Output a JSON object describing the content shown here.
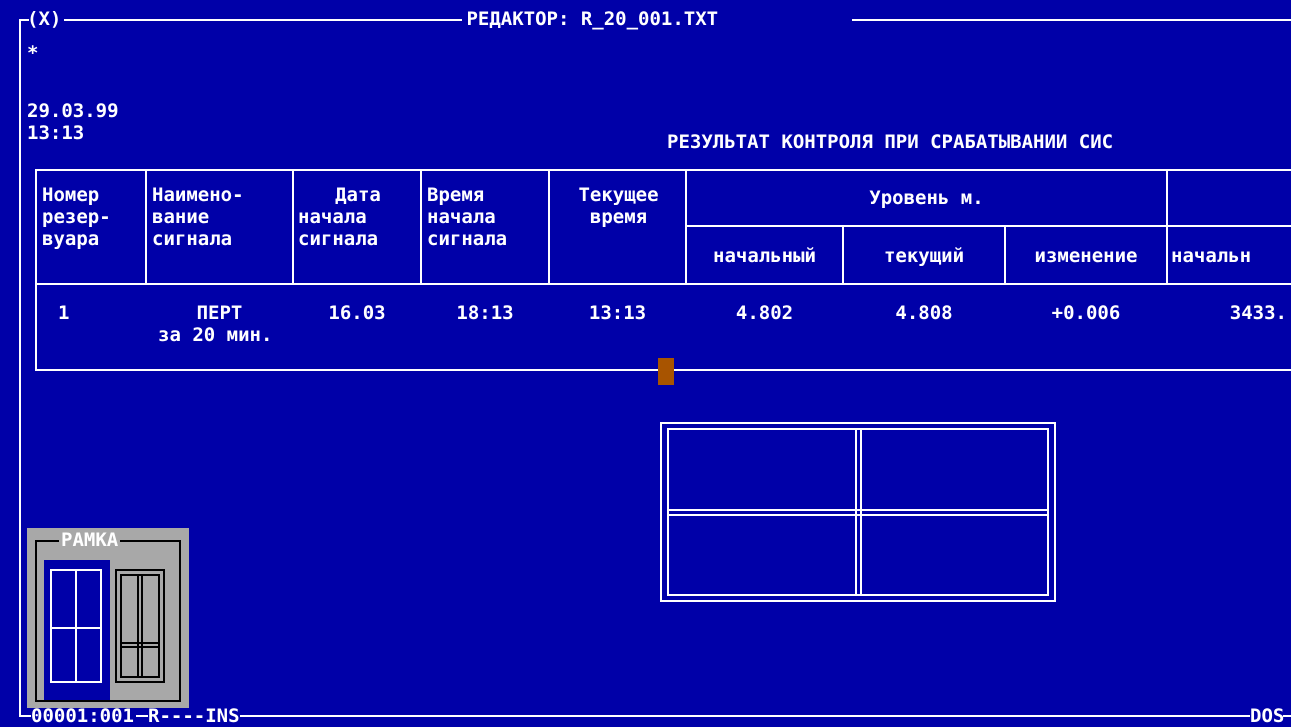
{
  "window": {
    "close_label": "(X)",
    "title": " РЕДАКТОР: R_20_001.TXT "
  },
  "editor": {
    "marker": "*",
    "date": "29.03.99",
    "time": "13:13",
    "heading": "РЕЗУЛЬТАТ КОНТРОЛЯ ПРИ СРАБАТЫВАНИИ СИС"
  },
  "table": {
    "headers": {
      "col1": [
        "Номер",
        "резер-",
        "вуара"
      ],
      "col2": [
        "Наимено-",
        "вание",
        "сигнала"
      ],
      "col3": [
        "Дата",
        "начала",
        "сигнала"
      ],
      "col4": [
        "Время",
        "начала",
        "сигнала"
      ],
      "col5": [
        "Текущее",
        "время"
      ],
      "group": "Уровень м.",
      "sub1": "начальный",
      "sub2": "текущий",
      "sub3": "изменение",
      "sub4": "начальн"
    },
    "row": {
      "num": "1",
      "name": "ПЕРТ",
      "name2": "за 20 мин.",
      "date": "16.03",
      "start": "18:13",
      "current": "13:13",
      "lvl_start": "4.802",
      "lvl_cur": "4.808",
      "lvl_change": "+0.006",
      "next_start": "3433."
    }
  },
  "frame_panel": {
    "label": "РАМКА"
  },
  "status": {
    "position": "00001:001",
    "mode": "R----INS",
    "encoding": "DOS"
  },
  "colors": {
    "background": "#0000a8",
    "text": "#ffffff",
    "cursor": "#a85400",
    "panel": "#a8a8a8"
  }
}
